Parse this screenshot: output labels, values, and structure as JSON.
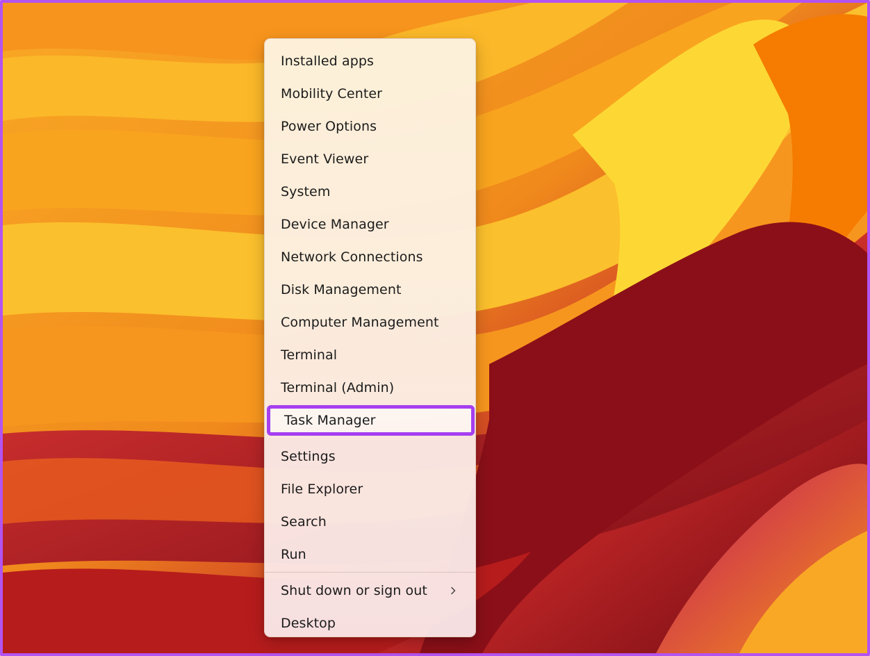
{
  "colors": {
    "accent_highlight": "#a53ff0",
    "frame_border": "#b353f0",
    "wallpaper": [
      "#f7a21b",
      "#fbc531",
      "#e8621c",
      "#c4261f",
      "#7a0a14",
      "#d81b60"
    ]
  },
  "menu": {
    "items": [
      {
        "label": "Installed apps"
      },
      {
        "label": "Mobility Center"
      },
      {
        "label": "Power Options"
      },
      {
        "label": "Event Viewer"
      },
      {
        "label": "System"
      },
      {
        "label": "Device Manager"
      },
      {
        "label": "Network Connections"
      },
      {
        "label": "Disk Management"
      },
      {
        "label": "Computer Management"
      },
      {
        "label": "Terminal"
      },
      {
        "label": "Terminal (Admin)"
      },
      {
        "label": "Task Manager",
        "highlighted": true
      },
      {
        "label": "Settings"
      },
      {
        "label": "File Explorer"
      },
      {
        "label": "Search"
      },
      {
        "label": "Run"
      }
    ],
    "bottom_items": [
      {
        "label": "Shut down or sign out",
        "has_submenu": true,
        "icon": "chevron-right-icon"
      },
      {
        "label": "Desktop"
      }
    ]
  }
}
